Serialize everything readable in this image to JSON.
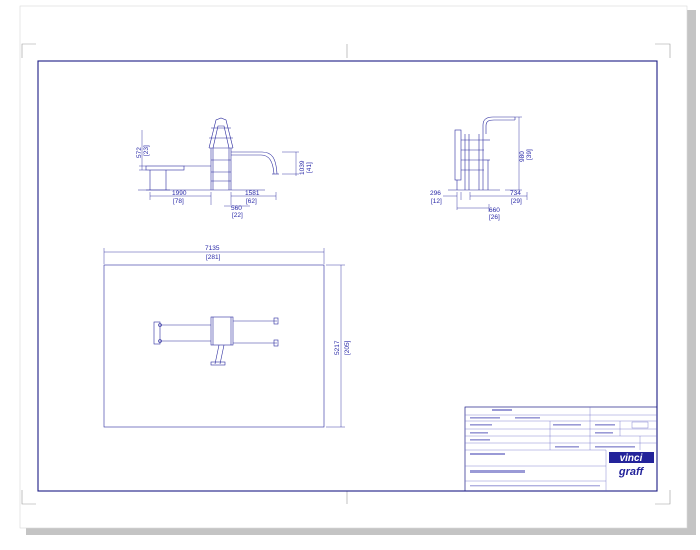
{
  "colors": {
    "drawing_line": "#2b2b9e",
    "border": "#1c1c86",
    "paper": "#ffffff",
    "frame_shadow": "#b8b8b8",
    "logo_blue": "#23239a"
  },
  "logo": {
    "line1": "vinci",
    "line2": "graff"
  },
  "side_view": {
    "height_572": "572",
    "height_572_in": "[23]",
    "height_1039": "1039",
    "height_1039_in": "[41]",
    "width_1990": "1990",
    "width_1990_in": "[78]",
    "width_1581": "1581",
    "width_1581_in": "[62]",
    "width_560": "560",
    "width_560_in": "[22]"
  },
  "end_view": {
    "height_980": "980",
    "height_980_in": "[39]",
    "width_296": "296",
    "width_296_in": "[12]",
    "width_734": "734",
    "width_734_in": "[29]",
    "width_660": "660",
    "width_660_in": "[26]"
  },
  "plan_view": {
    "length_7135": "7135",
    "length_7135_in": "[281]",
    "width_5217": "5217",
    "width_5217_in": "[205]"
  }
}
